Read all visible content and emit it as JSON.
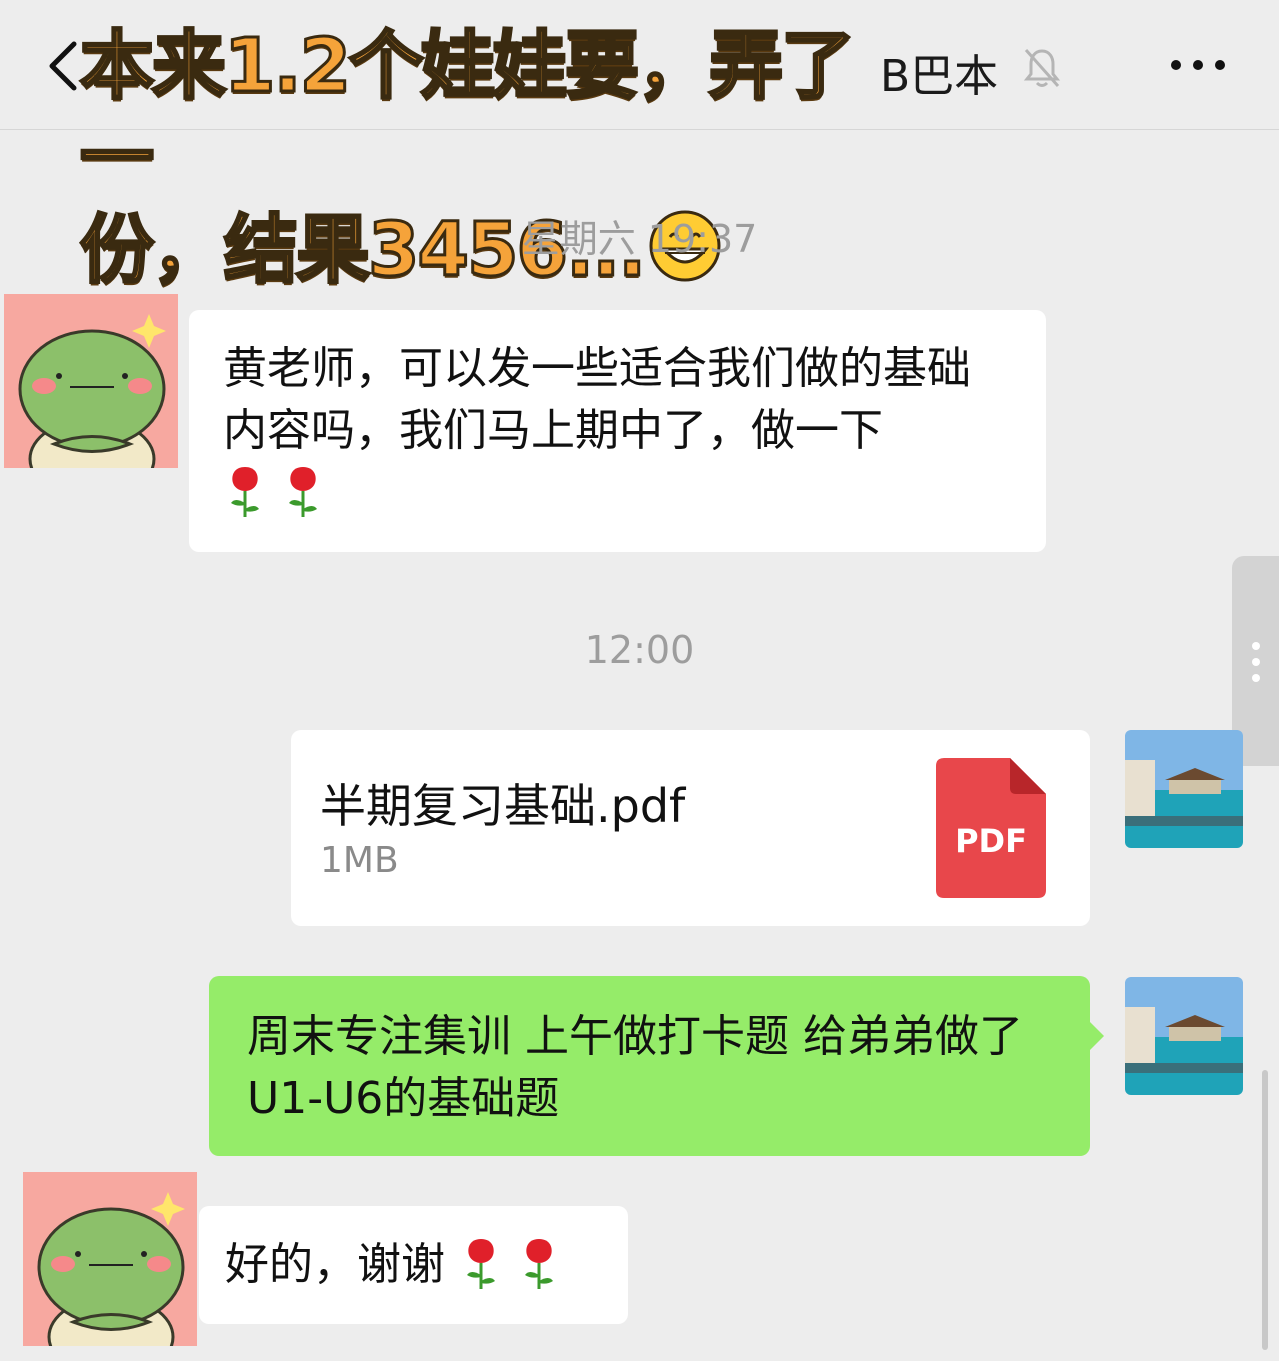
{
  "header": {
    "back_icon": "chevron-left-icon",
    "title_visible_tail": "B巴本",
    "mute_icon": "bell-off-icon",
    "more_icon": "more-dots-icon"
  },
  "overlay_caption": {
    "line1": "本来1.2个娃娃要，弄了一",
    "line2": "份，结果3456...",
    "emoji": "grinning-face"
  },
  "messages": {
    "ts1": "星期六 19:37",
    "m1_text": "黄老师，可以发一些适合我们做的基础内容吗，我们马上期中了，做一下",
    "ts2": "12:00",
    "file": {
      "name": "半期复习基础.pdf",
      "size": "1MB",
      "type_label": "PDF"
    },
    "m3_text": "周末专注集训 上午做打卡题 给弟弟做了U1-U6的基础题",
    "m4_text": "好的，谢谢"
  },
  "colors": {
    "background": "#ededed",
    "incoming_bubble": "#ffffff",
    "outgoing_bubble": "#95ec69",
    "pdf_red": "#e8474b",
    "overlay_orange": "#f5a33a"
  }
}
